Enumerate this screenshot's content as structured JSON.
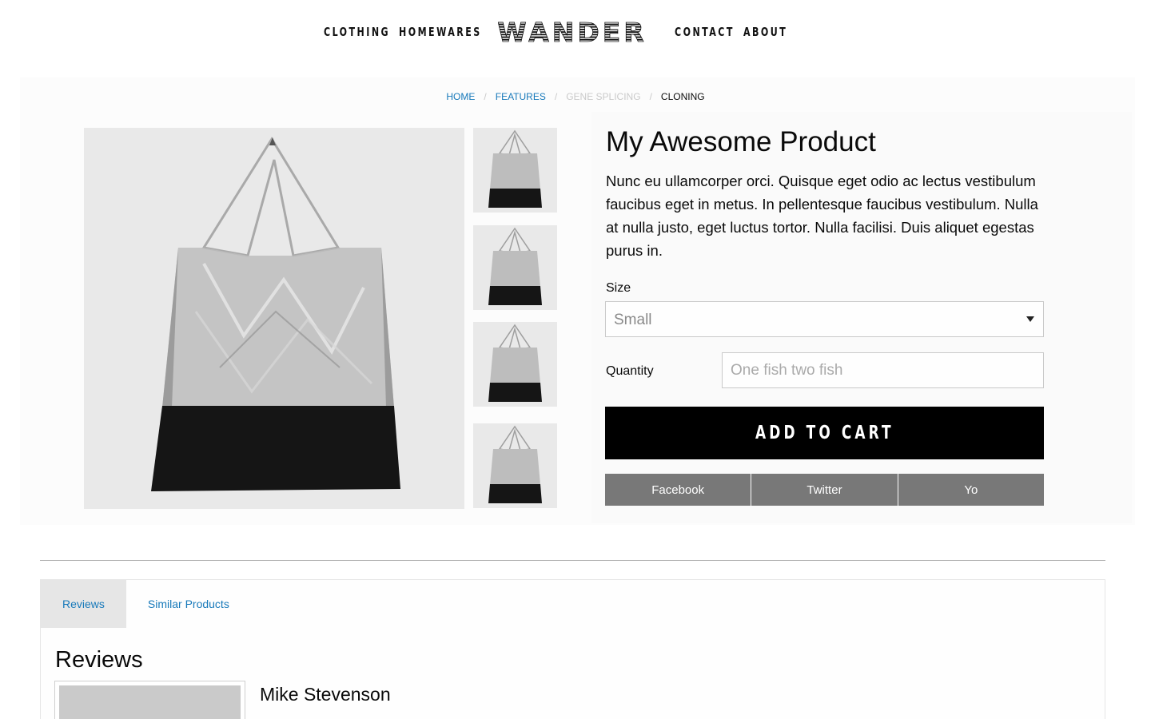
{
  "nav": {
    "left_links": [
      "CLOTHING",
      "HOMEWARES"
    ],
    "logo_text": "WANDER",
    "right_links": [
      "CONTACT",
      "ABOUT"
    ]
  },
  "breadcrumbs": [
    {
      "label": "HOME",
      "state": "link"
    },
    {
      "label": "FEATURES",
      "state": "link"
    },
    {
      "label": "GENE SPLICING",
      "state": "disabled"
    },
    {
      "label": "CLONING",
      "state": "current"
    }
  ],
  "breadcrumb_separator": "/",
  "product": {
    "title": "My Awesome Product",
    "description": "Nunc eu ullamcorper orci. Quisque eget odio ac lectus vestibulum faucibus eget in metus. In pellentesque faucibus vestibulum. Nulla at nulla justo, eget luctus tortor. Nulla facilisi. Duis aliquet egestas purus in.",
    "main_image_icon": "bag-photo",
    "thumbnail_icons": [
      "bag-thumbnail",
      "bag-thumbnail",
      "bag-thumbnail",
      "bag-thumbnail"
    ]
  },
  "form": {
    "size_label": "Size",
    "size_selected": "Small",
    "quantity_label": "Quantity",
    "quantity_placeholder": "One fish two fish",
    "add_to_cart_label": "ADD TO CART"
  },
  "share": {
    "buttons": [
      "Facebook",
      "Twitter",
      "Yo"
    ]
  },
  "tabs": {
    "items": [
      "Reviews",
      "Similar Products"
    ],
    "active": "Reviews"
  },
  "reviews": {
    "heading": "Reviews",
    "items": [
      {
        "author": "Mike Stevenson"
      }
    ]
  },
  "colors": {
    "link": "#1779ba",
    "button_dark": "#000000",
    "share_button": "#787878",
    "active_tab": "#e6e6e6"
  }
}
